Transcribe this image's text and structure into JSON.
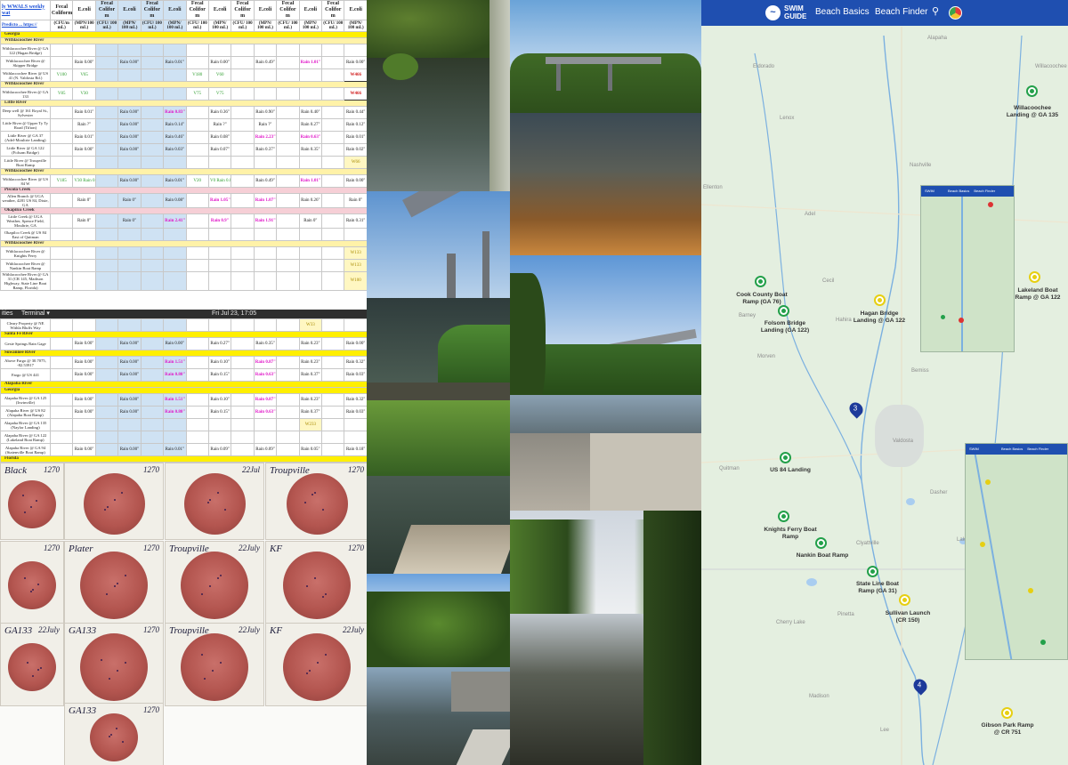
{
  "sheet": {
    "link1": "ly WWALS weekly wat",
    "link2": "Predicto ... https://",
    "headers": [
      "Fecal Coliform",
      "E.coli",
      "Fecal Colifor m",
      "E.coli",
      "Fecal Colifor m",
      "E.coli",
      "Fecal Colifor m",
      "E.coli",
      "Fecal Colifor m",
      "E.coli",
      "Fecal Colifor m",
      "E.coli",
      "Fecal Colifor m",
      "E.coli"
    ],
    "units": [
      "(CFU/m mL)",
      "(MPN/100 mL)",
      "(CFU/ 100 mL)",
      "(MPN/ 100 mL)",
      "(CFU/ 100 mL)",
      "(MPN/ 100 mL)",
      "(CFU/ 100 mL)",
      "(MPN/ 100 mL)",
      "(CFU/ 100 mL)",
      "(MPN/ 100 mL)",
      "(CFU/ 100 mL)",
      "(MPN/ 100 mL)",
      "(CFU/ 100 mL)",
      "(MPN/ 100 mL)"
    ],
    "rows": [
      {
        "band": "Georgia"
      },
      {
        "band": "Withlacoochee River",
        "style": "light"
      },
      {
        "site": "Withlacoochee River @ GA 122 (Hagan Bridge)",
        "cells": [
          "",
          "",
          "",
          "",
          "",
          "",
          "",
          "",
          "",
          "",
          "",
          "",
          "",
          ""
        ]
      },
      {
        "site": "Withlacoochee River @ Skipper Bridge",
        "cells": [
          "",
          "Rain 0.00\"",
          "",
          "Rain 0.00\"",
          "",
          "Rain 0.01\"",
          "",
          "Rain 0.00\"",
          "",
          "Rain 0.49\"",
          "",
          "Rain 1.01\"",
          "",
          "Rain 0.00\""
        ],
        "mag": [
          11
        ]
      },
      {
        "site": "Withlacoochee River @ US 41 (N. Valdosta Rd.)",
        "cells": [
          "V100",
          "V65",
          "",
          "",
          "",
          "",
          "V180",
          "V60",
          "",
          "",
          "",
          "",
          "",
          "W466"
        ],
        "grn": [
          0,
          1,
          6,
          7
        ],
        "red": [
          13
        ]
      },
      {
        "band": "Withlacoochee River",
        "style": "light"
      },
      {
        "site": "Withlacoochee River @ GA 133",
        "cells": [
          "V85",
          "V30",
          "",
          "",
          "",
          "",
          "V75",
          "V75",
          "",
          "",
          "",
          "",
          "",
          "W466"
        ],
        "grn": [
          0,
          1,
          6,
          7
        ],
        "red": [
          13
        ]
      },
      {
        "band": "Little River",
        "style": "light"
      },
      {
        "site": "Deep well @ 161 Royal St., Sylvester",
        "cells": [
          "",
          "Rain 0.01\"",
          "",
          "Rain 0.00\"",
          "",
          "Rain 0.83\"",
          "",
          "Rain 0.36\"",
          "",
          "Rain 0.90\"",
          "",
          "Rain 0.40\"",
          "",
          "Rain 0.44\""
        ],
        "mag": [
          5
        ]
      },
      {
        "site": "Little River @ Upper Ty Ty Road (Tifton)",
        "cells": [
          "",
          "Rain ?\"",
          "",
          "Rain 0.00\"",
          "",
          "Rain 0.14\"",
          "",
          "Rain ?\"",
          "",
          "Rain ?\"",
          "",
          "Rain 0.27\"",
          "",
          "Rain 0.12\""
        ]
      },
      {
        "site": "Little River @ GA 37 (Adel-Moultrie Landing)",
        "cells": [
          "",
          "Rain 0.01\"",
          "",
          "Rain 0.00\"",
          "",
          "Rain 0.46\"",
          "",
          "Rain 0.08\"",
          "",
          "Rain 2.23\"",
          "",
          "Rain 0.63\"",
          "",
          "Rain 0.01\""
        ],
        "mag": [
          9,
          11
        ]
      },
      {
        "site": "Little River @ GA 122 (Folsom Bridge)",
        "cells": [
          "",
          "Rain 0.00\"",
          "",
          "Rain 0.00\"",
          "",
          "Rain 0.03\"",
          "",
          "Rain 0.07\"",
          "",
          "Rain 0.37\"",
          "",
          "Rain 0.35\"",
          "",
          "Rain 0.02\""
        ]
      },
      {
        "site": "Little River @ Troupville Boat Ramp",
        "cells": [
          "",
          "",
          "",
          "",
          "",
          "",
          "",
          "",
          "",
          "",
          "",
          "",
          "",
          "W66"
        ],
        "ylw": [
          13
        ]
      },
      {
        "band": "Withlacoochee River",
        "style": "light"
      },
      {
        "site": "Withlacoochee River @ US 84 W",
        "cells": [
          "V185",
          "V30 Rain 0.00\"",
          "",
          "Rain 0.00\"",
          "",
          "Rain 0.01\"",
          "V20",
          "V0 Rain 0.00\"",
          "",
          "Rain 0.49\"",
          "",
          "Rain 1.01\"",
          "",
          "Rain 0.00\""
        ],
        "grn": [
          0,
          1,
          6,
          7
        ],
        "mag": [
          11
        ]
      },
      {
        "band": "Piscola Creek",
        "style": "pink"
      },
      {
        "site": "Allen Branch @ UGA weather, 4281 US 84, Dixie, GA",
        "cells": [
          "",
          "Rain 0\"",
          "",
          "Rain 0\"",
          "",
          "Rain 0.08\"",
          "",
          "Rain 1.05\"",
          "",
          "Rain 1.07\"",
          "",
          "Rain 0.26\"",
          "",
          "Rain 0\""
        ],
        "mag": [
          7,
          9
        ]
      },
      {
        "band": "Okapilco Creek",
        "style": "pink"
      },
      {
        "site": "Little Creek @ UGA Weather, Spence Field, Moultrie, GA",
        "cells": [
          "",
          "Rain 0\"",
          "",
          "Rain 0\"",
          "",
          "Rain 2.41\"",
          "",
          "Rain 0.9\"",
          "",
          "Rain 1.91\"",
          "",
          "Rain 0\"",
          "",
          "Rain 0.31\""
        ],
        "mag": [
          5,
          7,
          9
        ]
      },
      {
        "site": "Okapilco Creek @ US 84 East of Quitman",
        "cells": [
          "",
          "",
          "",
          "",
          "",
          "",
          "",
          "",
          "",
          "",
          "",
          "",
          "",
          ""
        ]
      },
      {
        "band": "Withlacoochee River",
        "style": "light"
      },
      {
        "site": "Withlacoochee River @ Knights Ferry",
        "cells": [
          "",
          "",
          "",
          "",
          "",
          "",
          "",
          "",
          "",
          "",
          "",
          "",
          "",
          "W133"
        ],
        "ylw": [
          13
        ]
      },
      {
        "site": "Withlacoochee River @ Nankin Boat Ramp",
        "cells": [
          "",
          "",
          "",
          "",
          "",
          "",
          "",
          "",
          "",
          "",
          "",
          "",
          "",
          "W133"
        ],
        "ylw": [
          13
        ]
      },
      {
        "site": "Withlacoochee River @ GA 31 (CR 145, Madison Highway, State Line Boat Ramp, Florida)",
        "cells": [
          "",
          "",
          "",
          "",
          "",
          "",
          "",
          "",
          "",
          "",
          "",
          "",
          "",
          "W100"
        ],
        "ylw": [
          13
        ]
      }
    ],
    "terminal_left": "ities",
    "terminal_app": "Terminal ▾",
    "terminal_clock": "Fri Jul 23, 17:05",
    "rows2": [
      {
        "site": "Cleary Property @ NE Withla Bluffs Way",
        "cells": [
          "",
          "",
          "",
          "",
          "",
          "",
          "",
          "",
          "",
          "",
          "",
          "W33",
          "",
          ""
        ],
        "ylw": [
          11
        ]
      },
      {
        "band": "Santa Fe River"
      },
      {
        "site": "Gesie Springs Rain Gage",
        "cells": [
          "",
          "Rain 0.00\"",
          "",
          "Rain 0.00\"",
          "",
          "Rain 0.00\"",
          "",
          "Rain 0.27\"",
          "",
          "Rain 0.35\"",
          "",
          "Rain 0.23\"",
          "",
          "Rain 0.00\""
        ]
      },
      {
        "band": "Suwannee River"
      },
      {
        "site": "Above Fargo @ 30.7075, -82.53917",
        "cells": [
          "",
          "Rain 0.00\"",
          "",
          "Rain 0.00\"",
          "",
          "Rain 1.51\"",
          "",
          "Rain 0.10\"",
          "",
          "Rain 0.87\"",
          "",
          "Rain 0.23\"",
          "",
          "Rain 0.32\""
        ],
        "mag": [
          5,
          9
        ]
      },
      {
        "site": "Fargo @ US 441",
        "cells": [
          "",
          "Rain 0.00\"",
          "",
          "Rain 0.00\"",
          "",
          "Rain 0.80\"",
          "",
          "Rain 0.15\"",
          "",
          "Rain 0.63\"",
          "",
          "Rain 0.37\"",
          "",
          "Rain 0.03\""
        ],
        "mag": [
          5,
          9
        ]
      },
      {
        "band": "Alapaha River"
      },
      {
        "band": "Georgia"
      },
      {
        "site": "Alapaha River @ GA 125 (Irwinville)",
        "cells": [
          "",
          "Rain 0.00\"",
          "",
          "Rain 0.00\"",
          "",
          "Rain 1.51\"",
          "",
          "Rain 0.10\"",
          "",
          "Rain 0.87\"",
          "",
          "Rain 0.23\"",
          "",
          "Rain 0.32\""
        ],
        "mag": [
          5,
          9
        ]
      },
      {
        "site": "Alapaha River @ US 82 (Alapaha Boat Ramp)",
        "cells": [
          "",
          "Rain 0.00\"",
          "",
          "Rain 0.00\"",
          "",
          "Rain 0.80\"",
          "",
          "Rain 0.15\"",
          "",
          "Rain 0.63\"",
          "",
          "Rain 0.37\"",
          "",
          "Rain 0.03\""
        ],
        "mag": [
          5,
          9
        ]
      },
      {
        "site": "Alapaha River @ GA 135 (Naylor Landing)",
        "cells": [
          "",
          "",
          "",
          "",
          "",
          "",
          "",
          "",
          "",
          "",
          "",
          "W233",
          "",
          ""
        ],
        "ylw": [
          11
        ]
      },
      {
        "site": "Alapaha River @ GA 122 (Lakeland Boat Ramp)",
        "cells": [
          "",
          "",
          "",
          "",
          "",
          "",
          "",
          "",
          "",
          "",
          "",
          "",
          "",
          ""
        ]
      },
      {
        "site": "Alapaha River @ GA 94 (Statenville Boat Ramp)",
        "cells": [
          "",
          "Rain 0.00\"",
          "",
          "Rain 0.00\"",
          "",
          "Rain 0.01\"",
          "",
          "Rain 0.09\"",
          "",
          "Rain 0.09\"",
          "",
          "Rain 0.05\"",
          "",
          "Rain 0.18\""
        ]
      },
      {
        "band": "Florida"
      }
    ]
  },
  "petri": {
    "dishes": [
      {
        "label": "Black",
        "num": "1270"
      },
      {
        "label": "",
        "num": "1270"
      },
      {
        "label": "",
        "num": "22Jul"
      },
      {
        "label": "Troupville",
        "num": "1270"
      },
      {
        "label": "",
        "num": "1270"
      },
      {
        "label": "Plater",
        "num": "1270"
      },
      {
        "label": "Troupville",
        "num": "22July"
      },
      {
        "label": "KF",
        "num": "1270"
      },
      {
        "label": "GA133",
        "num": "22July"
      },
      {
        "label": "GA133",
        "num": "1270"
      },
      {
        "label": "Troupville",
        "num": "22July"
      },
      {
        "label": "KF",
        "num": "22July"
      },
      {
        "label": "GA133",
        "num": "1270"
      }
    ]
  },
  "map": {
    "brand_line1": "SWIM",
    "brand_line2": "GUIDE",
    "nav": [
      "Beach Basics",
      "Beach Finder"
    ],
    "search_icon": "search-icon",
    "towns": [
      "Alapaha",
      "Eldorado",
      "Willacoochee",
      "Lenox",
      "Nashville",
      "Ellenton",
      "Adel",
      "Cecil",
      "Barney",
      "Hahira",
      "Morven",
      "Bemiss",
      "Valdosta",
      "Quitman",
      "Dasher",
      "Clyattville",
      "Lake",
      "Pinetta",
      "Cherry Lake",
      "Madison",
      "Lee"
    ],
    "beaches": [
      {
        "name": "Willacoochee Landing @ GA 135",
        "status": "green"
      },
      {
        "name": "Cook County Boat Ramp (GA 76)",
        "status": "green"
      },
      {
        "name": "Folsom Bridge Landing (GA 122)",
        "status": "green"
      },
      {
        "name": "Hagan Bridge Landing @ GA 122",
        "status": "yellow"
      },
      {
        "name": "Lakeland Boat Ramp @ GA 122",
        "status": "yellow"
      },
      {
        "name": "US 84 Landing",
        "status": "green"
      },
      {
        "name": "Knights Ferry Boat Ramp",
        "status": "green"
      },
      {
        "name": "Nankin Boat Ramp",
        "status": "green"
      },
      {
        "name": "State Line Boat Ramp (GA 31)",
        "status": "green"
      },
      {
        "name": "Sullivan Launch (CR 150)",
        "status": "yellow"
      },
      {
        "name": "Gibson Park Ramp @ CR 751",
        "status": "yellow"
      }
    ],
    "clusters": [
      "3",
      "4"
    ],
    "inset_nav": [
      "Beach Basics",
      "Beach Finder"
    ]
  },
  "colors": {
    "swim_blue": "#1f4fb0",
    "band_yellow": "#ffef00",
    "magenta": "#e015c8",
    "status_green": "#23a04a",
    "status_yellow": "#e6cf12"
  }
}
